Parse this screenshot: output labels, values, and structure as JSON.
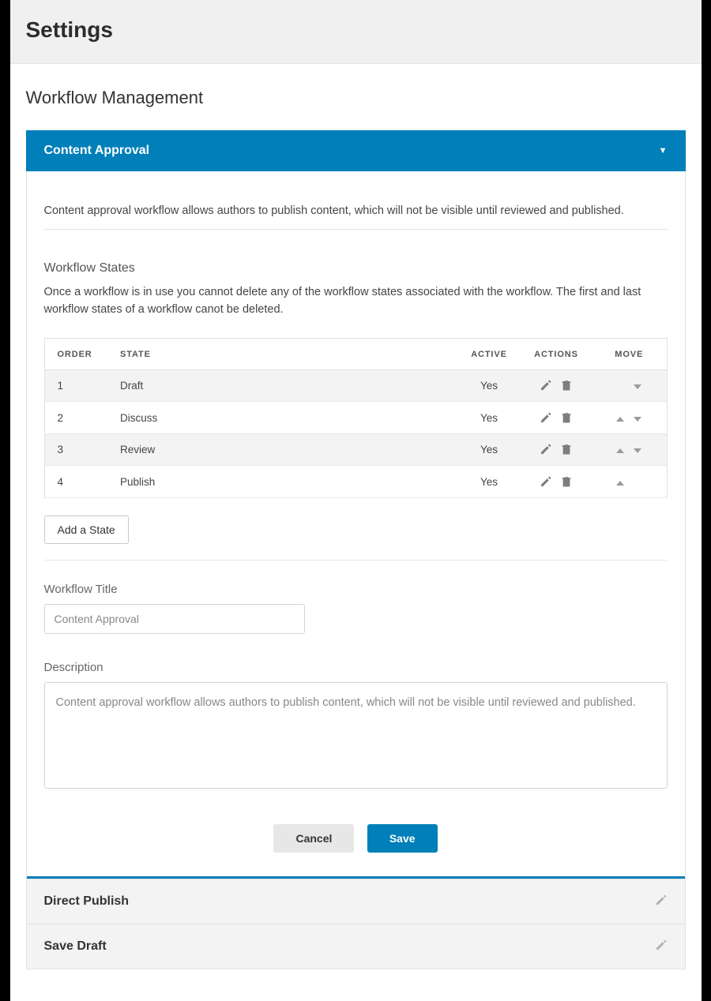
{
  "header": {
    "title": "Settings"
  },
  "page": {
    "section_title": "Workflow Management"
  },
  "workflow_panel": {
    "title": "Content Approval",
    "intro": "Content approval workflow allows authors to publish content, which will not be visible until reviewed and published.",
    "states_heading": "Workflow States",
    "states_hint": "Once a workflow is in use you cannot delete any of the workflow states associated with the workflow. The first and last workflow states of a workflow canot be deleted.",
    "table": {
      "headers": {
        "order": "ORDER",
        "state": "STATE",
        "active": "ACTIVE",
        "actions": "ACTIONS",
        "move": "MOVE"
      },
      "rows": [
        {
          "order": "1",
          "state": "Draft",
          "active": "Yes",
          "can_up": false,
          "can_down": true
        },
        {
          "order": "2",
          "state": "Discuss",
          "active": "Yes",
          "can_up": true,
          "can_down": true
        },
        {
          "order": "3",
          "state": "Review",
          "active": "Yes",
          "can_up": true,
          "can_down": true
        },
        {
          "order": "4",
          "state": "Publish",
          "active": "Yes",
          "can_up": true,
          "can_down": false
        }
      ]
    },
    "add_state_label": "Add a State",
    "title_label": "Workflow Title",
    "title_value": "Content Approval",
    "description_label": "Description",
    "description_value": "Content approval workflow allows authors to publish content, which will not be visible until reviewed and published.",
    "cancel_label": "Cancel",
    "save_label": "Save"
  },
  "other_workflows": [
    {
      "title": "Direct Publish"
    },
    {
      "title": "Save Draft"
    }
  ]
}
